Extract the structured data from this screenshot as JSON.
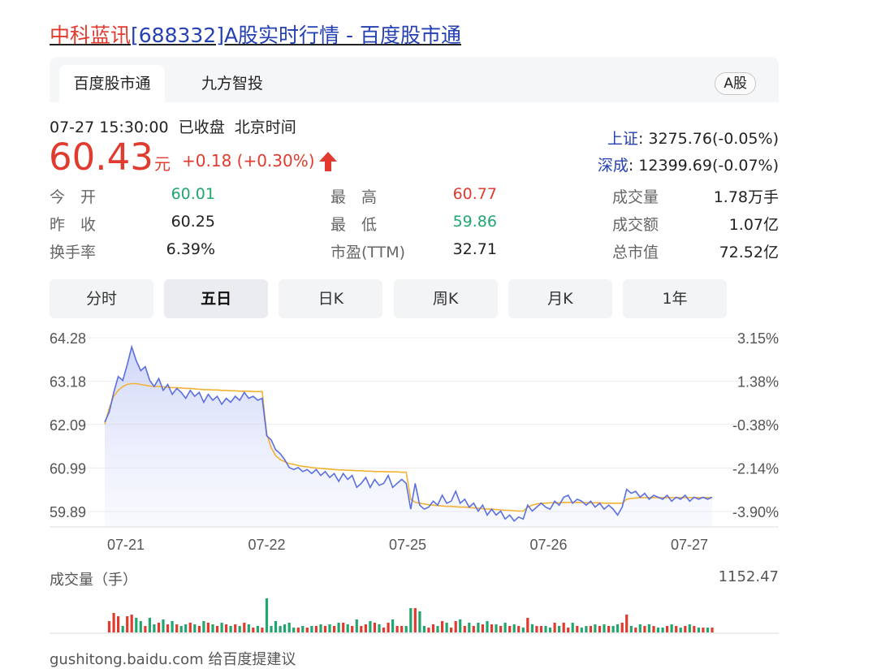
{
  "page": {
    "title_name": "中科蓝讯",
    "title_rest": "[688332]A股实时行情 - 百度股市通"
  },
  "tabs": [
    "百度股市通",
    "九方智投"
  ],
  "market_badge": "A股",
  "quote": {
    "timestamp": "07-27 15:30:00",
    "status": "已收盘",
    "timezone": "北京时间",
    "price": "60.43",
    "unit": "元",
    "change": "+0.18 (+0.30%)",
    "direction": "up"
  },
  "indices": [
    {
      "name": "上证",
      "value": ": 3275.76(-0.05%)"
    },
    {
      "name": "深成",
      "value": ": 12399.69(-0.07%)"
    }
  ],
  "stats": [
    {
      "label": "今　开",
      "value": "60.01",
      "tone": "green"
    },
    {
      "label": "最　高",
      "value": "60.77",
      "tone": "red"
    },
    {
      "label": "成交量",
      "value": "1.78万手",
      "tone": "plain"
    },
    {
      "label": "昨　收",
      "value": "60.25",
      "tone": "plain"
    },
    {
      "label": "最　低",
      "value": "59.86",
      "tone": "green"
    },
    {
      "label": "成交额",
      "value": "1.07亿",
      "tone": "plain"
    },
    {
      "label": "换手率",
      "value": "6.39%",
      "tone": "plain"
    },
    {
      "label": "市盈(TTM)",
      "value": "32.71",
      "tone": "plain"
    },
    {
      "label": "总市值",
      "value": "72.52亿",
      "tone": "plain"
    }
  ],
  "periods": {
    "items": [
      "分时",
      "五日",
      "日K",
      "周K",
      "月K",
      "1年"
    ],
    "active": "五日"
  },
  "colors": {
    "up": "#e03b2e",
    "down": "#21a66f",
    "price_line": "#5a6fe0",
    "avg_line": "#f2b233"
  },
  "chart_data": {
    "type": "line",
    "title": "",
    "x_labels": [
      "07-21",
      "07-22",
      "07-25",
      "07-26",
      "07-27"
    ],
    "y_ticks": [
      "64.28",
      "63.18",
      "62.09",
      "60.99",
      "59.89"
    ],
    "y_ticks_right": [
      "3.15%",
      "1.38%",
      "-0.38%",
      "-2.14%",
      "-3.90%"
    ],
    "ylim": [
      59.5,
      64.28
    ],
    "volume_label": "成交量（手）",
    "volume_max": "1152.47",
    "series": [
      {
        "key": "price",
        "values": [
          62.15,
          62.4,
          62.9,
          63.3,
          63.2,
          63.6,
          64.05,
          63.7,
          63.45,
          63.55,
          63.2,
          63.05,
          63.25,
          62.95,
          63.1,
          62.85,
          63.0,
          62.9,
          62.75,
          62.95,
          62.8,
          62.9,
          62.65,
          62.85,
          62.7,
          62.8,
          62.6,
          62.75,
          62.65,
          62.8,
          62.7,
          62.9,
          62.75,
          62.8,
          62.7,
          62.75,
          61.8,
          61.7,
          61.45,
          61.35,
          61.2,
          61.0,
          60.95,
          61.0,
          60.9,
          60.95,
          60.85,
          60.95,
          60.8,
          60.9,
          60.75,
          60.85,
          60.65,
          60.85,
          60.7,
          60.8,
          60.5,
          60.6,
          60.75,
          60.5,
          60.7,
          60.55,
          60.6,
          60.8,
          60.5,
          60.6,
          60.7,
          60.6,
          59.95,
          60.6,
          60.05,
          59.95,
          60.0,
          60.15,
          60.05,
          60.3,
          60.1,
          60.15,
          60.4,
          60.1,
          60.2,
          60.0,
          60.1,
          59.9,
          60.05,
          59.8,
          59.95,
          59.8,
          59.9,
          59.7,
          59.8,
          59.65,
          59.75,
          59.7,
          60.05,
          59.9,
          60.0,
          60.1,
          60.0,
          59.95,
          60.15,
          60.05,
          60.25,
          60.3,
          60.1,
          60.2,
          60.15,
          60.05,
          60.15,
          60.0,
          60.1,
          59.95,
          60.05,
          59.95,
          59.8,
          60.0,
          60.45,
          60.35,
          60.4,
          60.25,
          60.35,
          60.2,
          60.3,
          60.25,
          60.2,
          60.3,
          60.15,
          60.25,
          60.2,
          60.3,
          60.15,
          60.25,
          60.2,
          60.25,
          60.2,
          60.25
        ]
      },
      {
        "key": "avg",
        "values": [
          62.1,
          62.5,
          62.8,
          62.95,
          63.05,
          63.1,
          63.12,
          63.12,
          63.1,
          63.08,
          63.06,
          63.05,
          63.05,
          63.04,
          63.03,
          63.02,
          63.02,
          63.01,
          63.0,
          63.0,
          62.99,
          62.98,
          62.97,
          62.97,
          62.96,
          62.96,
          62.95,
          62.95,
          62.94,
          62.94,
          62.93,
          62.93,
          62.93,
          62.92,
          62.92,
          62.92,
          61.85,
          61.5,
          61.3,
          61.2,
          61.15,
          61.1,
          61.08,
          61.05,
          61.03,
          61.02,
          61.0,
          60.99,
          60.98,
          60.97,
          60.96,
          60.95,
          60.94,
          60.94,
          60.93,
          60.93,
          60.92,
          60.92,
          60.91,
          60.91,
          60.9,
          60.9,
          60.9,
          60.89,
          60.89,
          60.89,
          60.88,
          60.88,
          60.2,
          60.12,
          60.1,
          60.08,
          60.06,
          60.05,
          60.04,
          60.03,
          60.02,
          60.02,
          60.01,
          60.0,
          60.0,
          59.99,
          59.98,
          59.97,
          59.96,
          59.95,
          59.95,
          59.94,
          59.93,
          59.92,
          59.92,
          59.91,
          59.9,
          59.9,
          60.0,
          60.05,
          60.08,
          60.1,
          60.1,
          60.11,
          60.11,
          60.11,
          60.12,
          60.12,
          60.12,
          60.12,
          60.12,
          60.11,
          60.11,
          60.11,
          60.11,
          60.1,
          60.1,
          60.1,
          60.1,
          60.1,
          60.2,
          60.22,
          60.23,
          60.24,
          60.24,
          60.24,
          60.24,
          60.24,
          60.24,
          60.24,
          60.24,
          60.24,
          60.24,
          60.24,
          60.24,
          60.24,
          60.24,
          60.24,
          60.24,
          60.24
        ]
      }
    ]
  },
  "footer": "gushitong.baidu.com    给百度提建议"
}
